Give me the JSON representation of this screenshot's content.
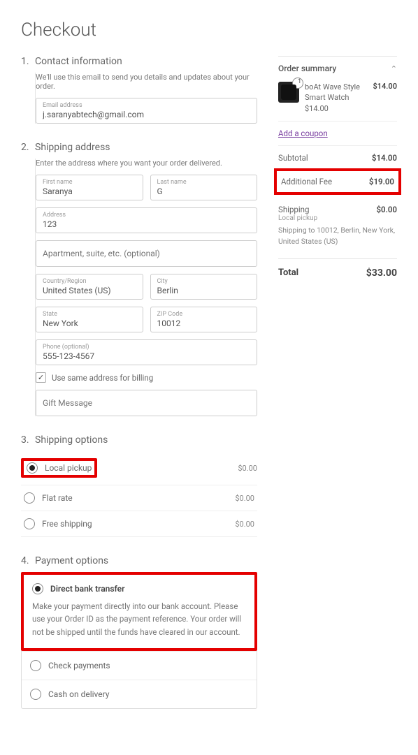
{
  "page": {
    "title": "Checkout"
  },
  "steps": {
    "contact": {
      "num": "1.",
      "title": "Contact information",
      "hint": "We'll use this email to send you details and updates about your order.",
      "email_label": "Email address",
      "email": "j.saranyabtech@gmail.com"
    },
    "shipping": {
      "num": "2.",
      "title": "Shipping address",
      "hint": "Enter the address where you want your order delivered.",
      "first_label": "First name",
      "first": "Saranya",
      "last_label": "Last name",
      "last": "G",
      "addr_label": "Address",
      "addr": "123",
      "addr2_placeholder": "Apartment, suite, etc. (optional)",
      "country_label": "Country/Region",
      "country": "United States (US)",
      "city_label": "City",
      "city": "Berlin",
      "state_label": "State",
      "state": "New York",
      "zip_label": "ZIP Code",
      "zip": "10012",
      "phone_label": "Phone (optional)",
      "phone": "555-123-4567",
      "same_billing": "Use same address for billing",
      "gift_placeholder": "Gift Message"
    },
    "options": {
      "num": "3.",
      "title": "Shipping options",
      "items": [
        {
          "label": "Local pickup",
          "price": "$0.00",
          "selected": true
        },
        {
          "label": "Flat rate",
          "price": "$0.00",
          "selected": false
        },
        {
          "label": "Free shipping",
          "price": "$0.00",
          "selected": false
        }
      ]
    },
    "payment": {
      "num": "4.",
      "title": "Payment options",
      "bank": {
        "label": "Direct bank transfer",
        "desc": "Make your payment directly into our bank account. Please use your Order ID as the payment reference. Your order will not be shipped until the funds have cleared in our account."
      },
      "check": "Check payments",
      "cod": "Cash on delivery"
    }
  },
  "summary": {
    "title": "Order summary",
    "item": {
      "name": "boAt Wave Style Smart Watch",
      "unit": "$14.00",
      "price": "$14.00",
      "qty": "1"
    },
    "coupon": "Add a coupon",
    "subtotal_label": "Subtotal",
    "subtotal": "$14.00",
    "fee_label": "Additional Fee",
    "fee": "$19.00",
    "ship_label": "Shipping",
    "ship": "$0.00",
    "ship_method": "Local pickup",
    "ship_to": "Shipping to 10012, Berlin, New York, United States (US)",
    "total_label": "Total",
    "total": "$33.00"
  }
}
